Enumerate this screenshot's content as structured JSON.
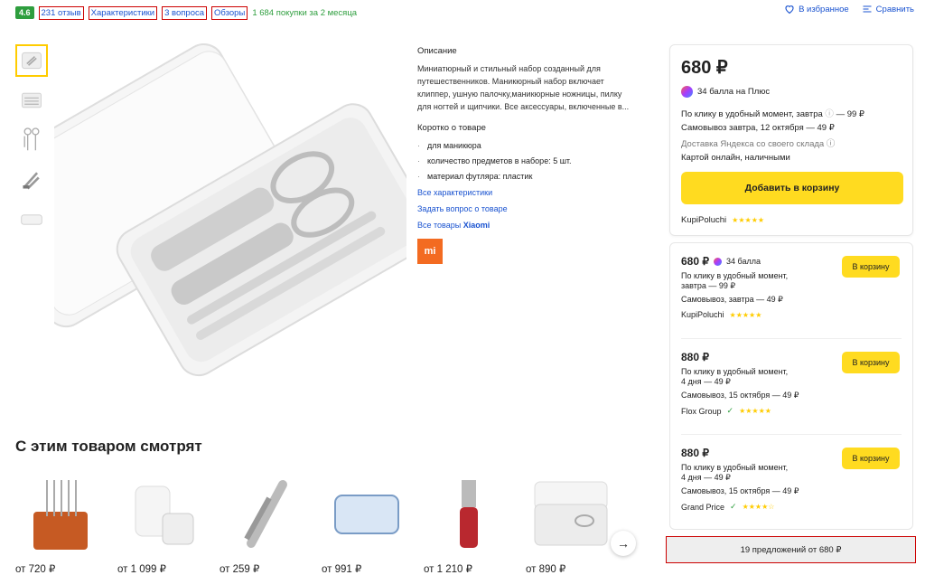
{
  "top": {
    "rating": "4.6",
    "reviews": "231 отзыв",
    "specs": "Характеристики",
    "questions": "3 вопроса",
    "overviews": "Обзоры",
    "purchases": "1 684 покупки за 2 месяца",
    "favorite": "В избранное",
    "compare": "Сравнить"
  },
  "description": {
    "title": "Описание",
    "text": "Миниатюрный и стильный набор созданный для путешественников. Маникюрный набор включает клиппер, ушную палочку,маникюрные ножницы, пилку для ногтей и щипчики. Все аксессуары, включенные в...",
    "brief_title": "Коротко о товаре",
    "features": [
      "для маникюра",
      "количество предметов в наборе: 5 шт.",
      "материал футляра: пластик"
    ],
    "all_specs": "Все характеристики",
    "ask": "Задать вопрос о товаре",
    "all_goods_prefix": "Все товары ",
    "brand": "Xiaomi",
    "brand_logo": "mi"
  },
  "buybox": {
    "price": "680 ₽",
    "plus": "34 балла на Плюс",
    "delivery1": "По клику в удобный момент, завтра",
    "delivery1_price": "— 99 ₽",
    "pickup": "Самовывоз завтра, 12 октября — 49 ₽",
    "yandex": "Доставка Яндекса со своего склада",
    "payment": "Картой онлайн, наличными",
    "add": "Добавить в корзину",
    "seller": "KupiPoluchi",
    "stars": "★★★★★"
  },
  "offers": [
    {
      "price": "680 ₽",
      "bonus": "34 балла",
      "l1": "По клику в удобный момент,",
      "l2": "завтра — 99 ₽",
      "l3": "Самовывоз, завтра — 49 ₽",
      "seller": "KupiPoluchi",
      "verified": false,
      "stars": "★★★★★",
      "btn": "В корзину"
    },
    {
      "price": "880 ₽",
      "bonus": "",
      "l1": "По клику в удобный момент,",
      "l2": "4 дня — 49 ₽",
      "l3": "Самовывоз, 15 октября — 49 ₽",
      "seller": "Flox Group",
      "verified": true,
      "stars": "★★★★★",
      "btn": "В корзину"
    },
    {
      "price": "880 ₽",
      "bonus": "",
      "l1": "По клику в удобный момент,",
      "l2": "4 дня — 49 ₽",
      "l3": "Самовывоз, 15 октября — 49 ₽",
      "seller": "Grand Price",
      "verified": true,
      "stars": "★★★★☆",
      "btn": "В корзину"
    }
  ],
  "all_offers": "19 предложений от 680 ₽",
  "recs_title": "С этим товаром смотрят",
  "recs": [
    {
      "price": "от 720 ₽"
    },
    {
      "price": "от 1 099 ₽"
    },
    {
      "price": "от 259 ₽"
    },
    {
      "price": "от 991 ₽"
    },
    {
      "price": "от 1 210 ₽"
    },
    {
      "price": "от 890 ₽"
    }
  ]
}
